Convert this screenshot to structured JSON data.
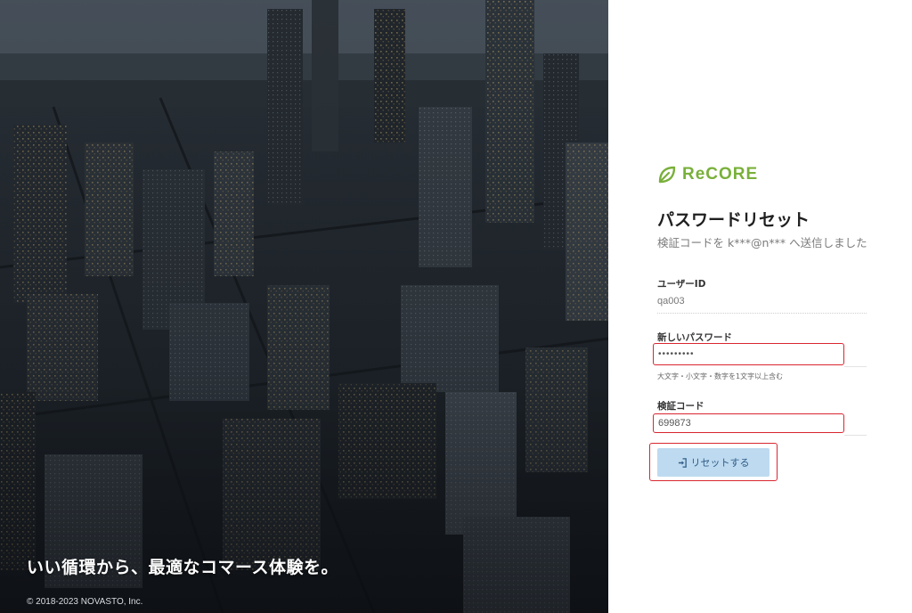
{
  "hero": {
    "tagline": "いい循環から、最適なコマース体験を。",
    "copyright": "© 2018-2023 NOVASTO, Inc."
  },
  "brand": {
    "name": "ReCORE",
    "icon": "leaf-logo-icon",
    "color": "#79b03a"
  },
  "form": {
    "title": "パスワードリセット",
    "subtitle": "検証コードを k***@n*** へ送信しました",
    "user_id_label": "ユーザーID",
    "user_id_value": "qa003",
    "new_password_label": "新しいパスワード",
    "new_password_value": "•••••••••",
    "password_hint": "大文字・小文字・数字を1文字以上含む",
    "code_label": "検証コード",
    "code_value": "699873",
    "submit_label": "リセットする",
    "submit_icon": "sign-in-icon"
  },
  "colors": {
    "highlight": "#d9262f",
    "button_bg": "#bedaf0",
    "button_text": "#2f5c86"
  }
}
